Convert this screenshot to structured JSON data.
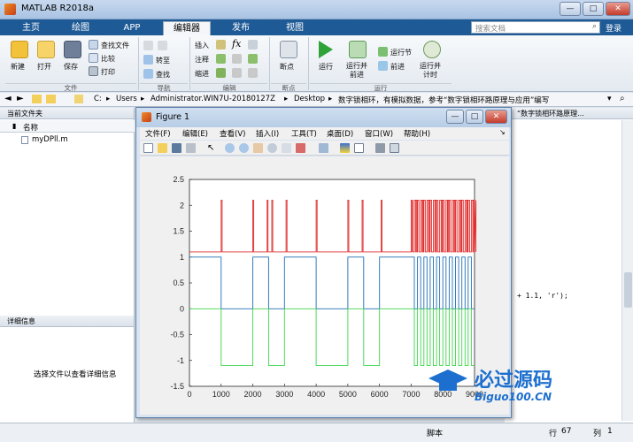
{
  "app": {
    "title": "MATLAB R2018a"
  },
  "quick_search": {
    "placeholder": "搜索文档",
    "login": "登录"
  },
  "tabs": [
    {
      "label": "主页",
      "active": false
    },
    {
      "label": "绘图",
      "active": false
    },
    {
      "label": "APP",
      "active": false
    },
    {
      "label": "编辑器",
      "active": true
    },
    {
      "label": "发布",
      "active": false
    },
    {
      "label": "视图",
      "active": false
    }
  ],
  "ribbon": {
    "file_group": {
      "label": "文件",
      "new": "新建",
      "open": "打开",
      "save": "保存",
      "find_files": "查找文件",
      "compare": "比较",
      "print": "打印"
    },
    "nav_group": {
      "label": "导航",
      "goto": "转至",
      "find": "查找"
    },
    "edit_group": {
      "label": "编辑",
      "insert": "插入",
      "comment": "注释",
      "indent": "缩进"
    },
    "bp_group": {
      "label": "断点",
      "breakpoints": "断点"
    },
    "run_group": {
      "label": "运行",
      "run": "运行",
      "run_advance": "运行并\n前进",
      "run_section": "运行节",
      "advance": "前进",
      "run_time": "运行并\n计时"
    }
  },
  "path": {
    "segments": [
      "C:",
      "Users",
      "Administrator.WIN7U-20180127Z",
      "Desktop",
      "数字锁相环，有模拟数据，参考“数字锁相环路原理与应用”编写"
    ]
  },
  "left_panel": {
    "header": "当前文件夹",
    "col_name": "名称",
    "files": [
      "myDPll.m"
    ]
  },
  "details_panel": {
    "header": "详细信息",
    "hint": "选择文件以查看详细信息"
  },
  "right_strip": {
    "tab_text": "“数字锁相环路原理...",
    "code_fragment": "+ 1.1, 'r');"
  },
  "status": {
    "label": "脚本",
    "row_label": "行",
    "row": "67",
    "col_label": "列",
    "col": "1"
  },
  "watermark": {
    "name": "必过源码",
    "url": "Biguo100.CN"
  },
  "figure": {
    "title": "Figure 1",
    "menus": [
      "文件(F)",
      "编辑(E)",
      "查看(V)",
      "插入(I)",
      "工具(T)",
      "桌面(D)",
      "窗口(W)",
      "帮助(H)"
    ]
  },
  "chart_data": {
    "type": "line",
    "xlim": [
      0,
      9000
    ],
    "ylim": [
      -1.5,
      2.5
    ],
    "xticks": [
      0,
      1000,
      2000,
      3000,
      4000,
      5000,
      6000,
      7000,
      8000,
      9000
    ],
    "yticks": [
      -1.5,
      -1,
      -0.5,
      0,
      0.5,
      1,
      1.5,
      2,
      2.5
    ],
    "grid": false,
    "series": [
      {
        "color": "#e03030",
        "kind": "pulse",
        "base": 1.1,
        "peak": 2.1,
        "pulses": [
          1000,
          2000,
          2450,
          2600,
          3050,
          4000,
          5000,
          5450,
          6050,
          7000,
          7150,
          7350,
          7550,
          7750,
          7950,
          8150,
          8350,
          8550,
          8750,
          8950
        ],
        "dense_from": 7000,
        "dense_period": 100
      },
      {
        "color": "#1f6fb5",
        "kind": "square",
        "high": 1,
        "low": 0,
        "transitions": [
          0,
          1000,
          2000,
          2500,
          3000,
          4000,
          5000,
          5500,
          6000,
          7000
        ],
        "start_high": true,
        "dense_from": 7000,
        "dense_period": 200
      },
      {
        "color": "#3ed64a",
        "kind": "square",
        "high": 0,
        "low": -1.1,
        "transitions": [
          0,
          1000,
          2000,
          2500,
          3000,
          4000,
          5000,
          5500,
          6000,
          7000
        ],
        "start_high": true,
        "dense_from": 7000,
        "dense_period": 200
      }
    ]
  }
}
